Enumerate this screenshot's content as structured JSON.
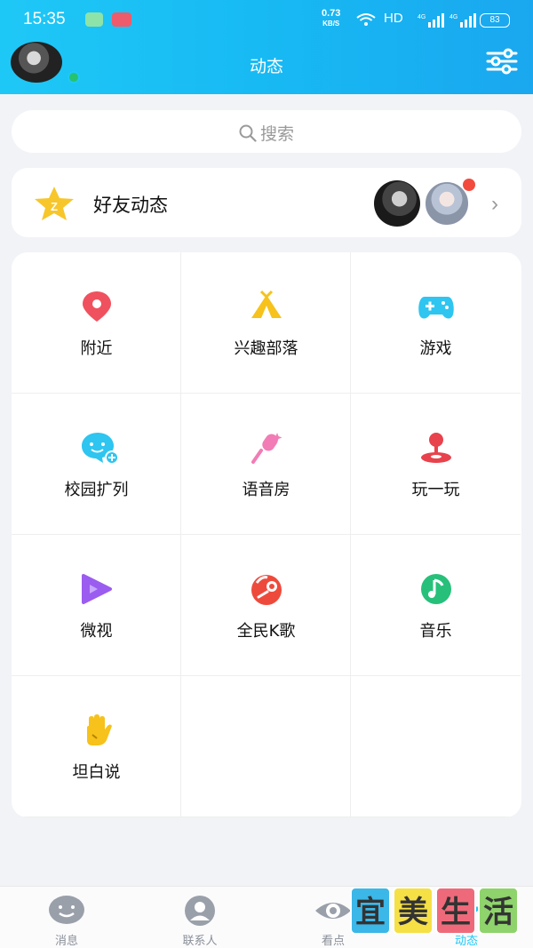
{
  "status_bar": {
    "time": "15:35",
    "net_speed": "0.73",
    "net_unit": "KB/S",
    "hd": "HD",
    "sig1": "4G",
    "sig2": "4G",
    "battery": "83"
  },
  "header": {
    "title": "动态",
    "accent_color": "#1ec8f6"
  },
  "search": {
    "placeholder": "搜索"
  },
  "friend_feed": {
    "label": "好友动态"
  },
  "grid": [
    {
      "label": "附近",
      "icon": "location-pin-icon",
      "color": "#f0515e"
    },
    {
      "label": "兴趣部落",
      "icon": "tent-icon",
      "color": "#f6c21b"
    },
    {
      "label": "游戏",
      "icon": "gamepad-icon",
      "color": "#2ec5f0"
    },
    {
      "label": "校园扩列",
      "icon": "chat-bubble-plus-icon",
      "color": "#2ec5f0"
    },
    {
      "label": "语音房",
      "icon": "microphone-icon",
      "color": "#f27cb6"
    },
    {
      "label": "玩一玩",
      "icon": "joystick-icon",
      "color": "#e8424c"
    },
    {
      "label": "微视",
      "icon": "play-icon",
      "color": "#9b5cf0"
    },
    {
      "label": "全民K歌",
      "icon": "karaoke-icon",
      "color": "#ee4a3c"
    },
    {
      "label": "音乐",
      "icon": "music-note-icon",
      "color": "#26c07a"
    },
    {
      "label": "坦白说",
      "icon": "hand-icon",
      "color": "#f6c21b"
    }
  ],
  "bottom_nav": [
    {
      "label": "消息",
      "icon": "message-icon"
    },
    {
      "label": "联系人",
      "icon": "contacts-icon"
    },
    {
      "label": "看点",
      "icon": "eye-icon"
    },
    {
      "label": "动态",
      "icon": "star-icon"
    }
  ],
  "watermark": [
    "宜",
    "美",
    "生",
    "活"
  ]
}
